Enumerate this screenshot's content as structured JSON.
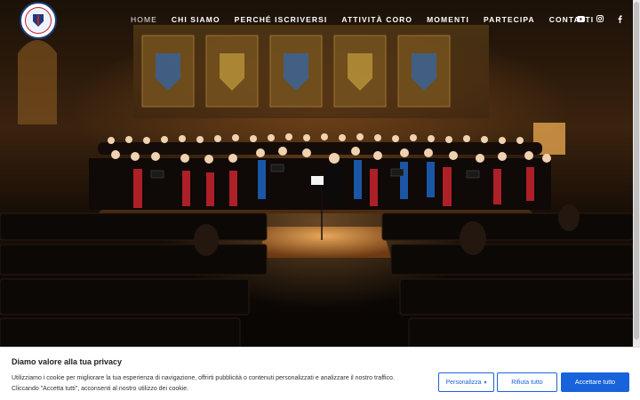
{
  "nav": {
    "items": [
      {
        "label": "HOME",
        "active": true
      },
      {
        "label": "CHI SIAMO"
      },
      {
        "label": "PERCHÉ ISCRIVERSI"
      },
      {
        "label": "ATTIVITÀ CORO"
      },
      {
        "label": "MOMENTI"
      },
      {
        "label": "PARTECIPA"
      },
      {
        "label": "CONTATTI"
      }
    ],
    "social": [
      "youtube-icon",
      "instagram-icon",
      "facebook-icon"
    ]
  },
  "colors": {
    "accent": "#1863dc",
    "banner_bg": "#ffffff",
    "choir_red": "#c0232b",
    "choir_blue": "#1d5fb8"
  },
  "cookie": {
    "title": "Diamo valore alla tua privacy",
    "text_line1": "Utilizziamo i cookie per migliorare la tua esperienza di navigazione, offrirti pubblicità o contenuti personalizzati e analizzare il nostro traffico.",
    "text_line2": "Cliccando \"Accetta tutti\", acconsenti al nostro utilizzo dei cookie.",
    "customize_label": "Personalizza",
    "reject_label": "Rifiuta tutto",
    "accept_label": "Accettare tutto"
  }
}
